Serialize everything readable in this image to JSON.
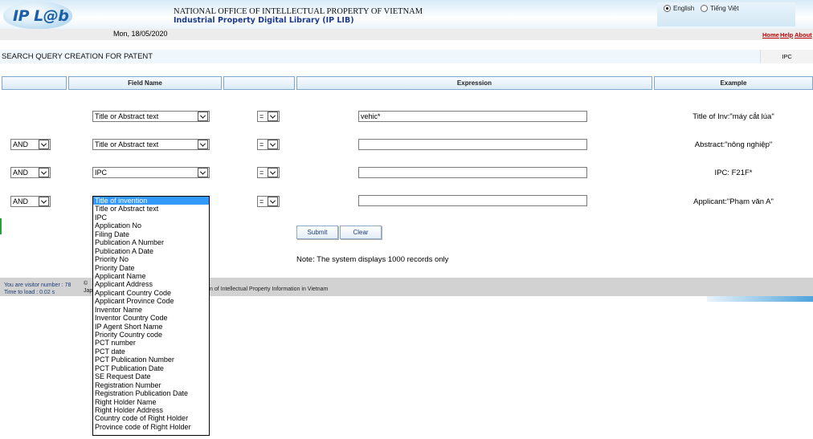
{
  "header": {
    "logo_text": "IP L@b",
    "org_title": "NATIONAL OFFICE OF INTELLECTUAL PROPERTY OF VIETNAM",
    "lib_title": "Industrial Property Digital Library (IP LIB)",
    "languages": [
      {
        "label": "English",
        "selected": true
      },
      {
        "label": "Tiếng Việt",
        "selected": false
      }
    ]
  },
  "datebar": {
    "date": "Mon, 18/05/2020",
    "links": [
      "Home",
      "Help",
      "About"
    ]
  },
  "page": {
    "title": "SEARCH QUERY CREATION FOR PATENT",
    "ipc_tab": "IPC"
  },
  "table": {
    "headers": [
      "",
      "Field Name",
      "",
      "Expression",
      "Example"
    ],
    "rows": [
      {
        "operator": "",
        "field": "Title or Abstract text",
        "comparison": "=",
        "expression": "vehic*",
        "example": "Title of Inv:\"máy cắt lúa\""
      },
      {
        "operator": "AND",
        "field": "Title or Abstract text",
        "comparison": "=",
        "expression": "",
        "example": "Abstract:\"nông nghiệp\""
      },
      {
        "operator": "AND",
        "field": "IPC",
        "comparison": "=",
        "expression": "",
        "example": "IPC: F21F*"
      },
      {
        "operator": "AND",
        "field": "Title of invention",
        "comparison": "=",
        "expression": "",
        "example": "Applicant:\"Phạm văn A\""
      }
    ]
  },
  "buttons": {
    "submit": "Submit",
    "clear": "Clear"
  },
  "note": "Note: The system displays 1000 records only",
  "footer": {
    "visitor": "You are visitor number : 78",
    "load_time": "Time to load : 0.02 s",
    "copyright_symbol": "©",
    "copyright_fragment": "Jap",
    "copyright_tail": "n of Intellectual Property Information in Vietnam"
  },
  "field_options": [
    "Title of invention",
    "Title or Abstract text",
    "IPC",
    "Application No",
    "Filing Date",
    "Publication A Number",
    "Publication A Date",
    "Priority No",
    "Priority Date",
    "Applicant Name",
    "Applicant Address",
    "Applicant Country Code",
    "Applicant Province Code",
    "Inventor Name",
    "Inventor Country Code",
    "IP Agent Short Name",
    "Priority Country code",
    "PCT number",
    "PCT date",
    "PCT Publication Number",
    "PCT Publication Date",
    "SE Request Date",
    "Registration Number",
    "Registration Publication Date",
    "Right Holder Name",
    "Right Holder Address",
    "Country code of Right Holder",
    "Province code of Right Holder"
  ],
  "colors": {
    "header_title": "#1c3a8c",
    "links": "#c00000",
    "selected_option": "#3399ff"
  }
}
